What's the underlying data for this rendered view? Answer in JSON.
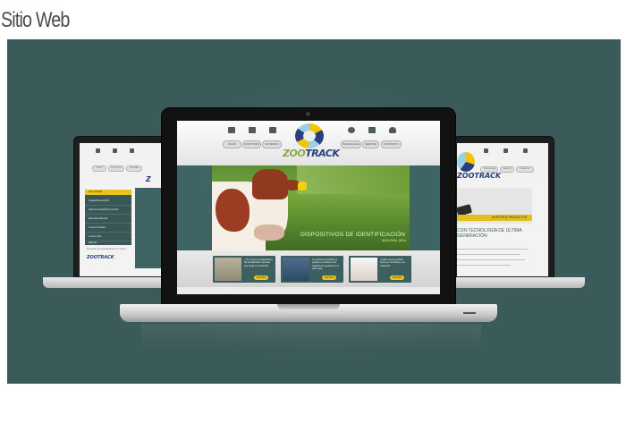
{
  "page": {
    "heading": "Sitio Web"
  },
  "main_site": {
    "nav_buttons": [
      "INICIO",
      "NOSOTROS",
      "SISTEMAS",
      "TECNOLOGÍA",
      "SERVICE",
      "CONTACTO"
    ],
    "logo_text_prefix": "ZOO",
    "logo_text_suffix": "TRACK",
    "banner_title": "DISPOSITIVOS DE IDENTIFICACIÓN",
    "banner_subtitle": "NACIONAL (DIN)",
    "features": [
      {
        "text": "¿Ya conoce los dispositivos de identificación nacional que exige el ministerio?",
        "more_label": "VER MÁS"
      },
      {
        "text": "Los lectores portátiles le ayudan a mantener sus registros de ganado en un solo lugar.",
        "more_label": "VER MÁS"
      },
      {
        "text": "¿Sabía que es posible poner un microchip a su mascota?",
        "more_label": "VER MÁS"
      }
    ]
  },
  "left_site": {
    "nav_buttons": [
      "INICIO",
      "NOSOTROS",
      "SISTEMAS"
    ],
    "menu_heading": "SOLUCIONES",
    "menu_items": [
      "Chapas Bovinas (DIN)",
      "Sistema de Identificación Animal",
      "Microchips Mascotas",
      "Lectores Portátiles",
      "Lectores Fijos",
      "Balanzas"
    ],
    "footer_text": "BIENVENIDO A LA NUEVA WEB DE ZOOTRACK",
    "footer_logo": "ZOOTRACK"
  },
  "right_site": {
    "nav_buttons": [
      "TECNOLOGÍA",
      "SERVICE",
      "CONTACTO"
    ],
    "logo": "ZOOTRACK",
    "banner_label": "NUESTROS PRODUCTOS",
    "tagline": "CON TECNOLOGÍA DE ÚLTIMA GENERACIÓN"
  },
  "colors": {
    "stage_background": "#3b5a5a",
    "accent_yellow": "#e9c619",
    "brand_blue": "#2a3f7f",
    "teal_panel": "#3e5f5f"
  }
}
